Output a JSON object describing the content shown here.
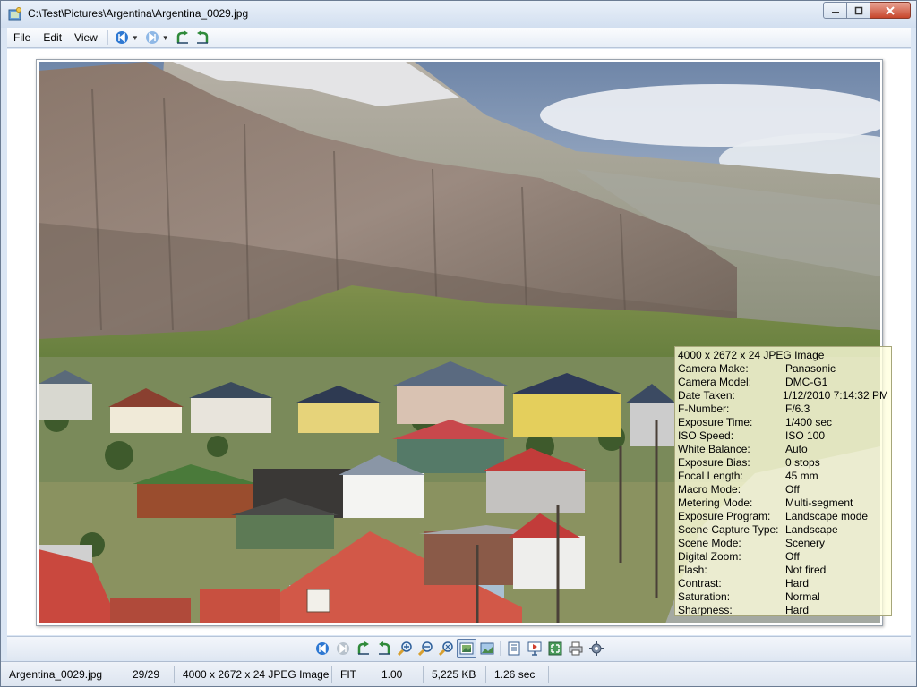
{
  "window": {
    "title": "C:\\Test\\Pictures\\Argentina\\Argentina_0029.jpg",
    "minimize_label": "▭",
    "maximize_label": "▢",
    "close_label": "✕"
  },
  "menu": {
    "items": [
      {
        "label": "File"
      },
      {
        "label": "Edit"
      },
      {
        "label": "View"
      }
    ],
    "toolbar_icons": [
      "previous-icon",
      "dropdown-icon",
      "next-icon",
      "dropdown-icon",
      "rotate-left-icon",
      "rotate-right-icon"
    ]
  },
  "info": {
    "header": "4000 x 2672 x 24 JPEG Image",
    "rows": [
      {
        "key": "Camera Make:",
        "value": "Panasonic"
      },
      {
        "key": "Camera Model:",
        "value": "DMC-G1"
      },
      {
        "key": "Date Taken:",
        "value": "1/12/2010 7:14:32 PM"
      },
      {
        "key": "F-Number:",
        "value": "F/6.3"
      },
      {
        "key": "Exposure Time:",
        "value": "1/400 sec"
      },
      {
        "key": "ISO Speed:",
        "value": "ISO 100"
      },
      {
        "key": "White Balance:",
        "value": "Auto"
      },
      {
        "key": "Exposure Bias:",
        "value": "0 stops"
      },
      {
        "key": "Focal Length:",
        "value": "45 mm"
      },
      {
        "key": "Macro Mode:",
        "value": "Off"
      },
      {
        "key": "Metering Mode:",
        "value": "Multi-segment"
      },
      {
        "key": "Exposure Program:",
        "value": "Landscape mode"
      },
      {
        "key": "Scene Capture Type:",
        "value": "Landscape"
      },
      {
        "key": "Scene Mode:",
        "value": "Scenery"
      },
      {
        "key": "Digital Zoom:",
        "value": "Off"
      },
      {
        "key": "Flash:",
        "value": "Not fired"
      },
      {
        "key": "Contrast:",
        "value": "Hard"
      },
      {
        "key": "Saturation:",
        "value": "Normal"
      },
      {
        "key": "Sharpness:",
        "value": "Hard"
      }
    ]
  },
  "bottom_toolbar": {
    "icons": [
      "previous-icon",
      "next-icon",
      "rotate-left-icon",
      "rotate-right-icon",
      "zoom-in-icon",
      "zoom-out-icon",
      "zoom-fit-icon",
      "fit-window-icon",
      "actual-size-icon",
      "info-icon",
      "slideshow-icon",
      "fullscreen-icon",
      "print-icon",
      "settings-icon"
    ]
  },
  "status": {
    "filename": "Argentina_0029.jpg",
    "position": "29/29",
    "image_info": "4000 x 2672 x 24 JPEG Image",
    "fit_mode": "FIT",
    "zoom": "1.00",
    "file_size": "5,225 KB",
    "load_time": "1.26 sec"
  }
}
